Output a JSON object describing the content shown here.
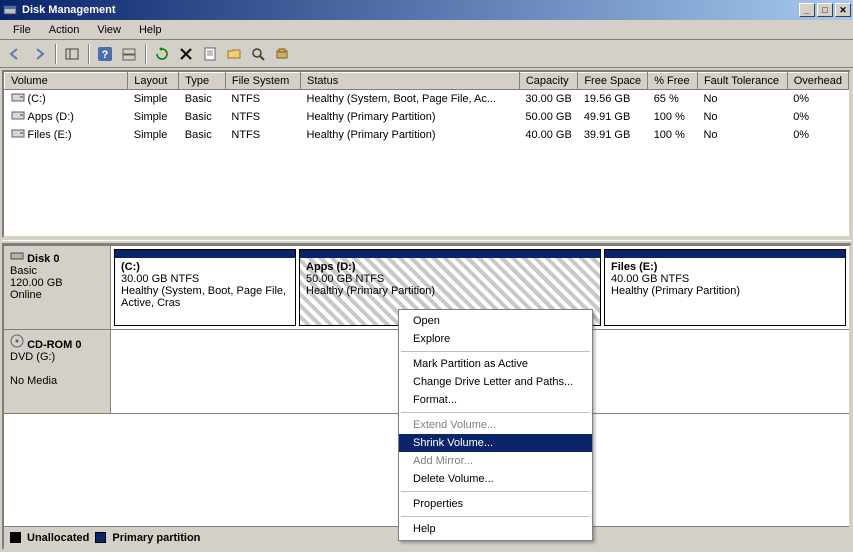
{
  "window": {
    "title": "Disk Management"
  },
  "menu": {
    "file": "File",
    "action": "Action",
    "view": "View",
    "help": "Help"
  },
  "columns": {
    "volume": "Volume",
    "layout": "Layout",
    "type": "Type",
    "fs": "File System",
    "status": "Status",
    "capacity": "Capacity",
    "free": "Free Space",
    "pct": "% Free",
    "fault": "Fault Tolerance",
    "overhead": "Overhead"
  },
  "volumes": [
    {
      "icon": "drive-icon",
      "name": "(C:)",
      "layout": "Simple",
      "type": "Basic",
      "fs": "NTFS",
      "status": "Healthy (System, Boot, Page File, Ac...",
      "capacity": "30.00 GB",
      "free": "19.56 GB",
      "pct": "65 %",
      "fault": "No",
      "overhead": "0%"
    },
    {
      "icon": "drive-icon",
      "name": "Apps (D:)",
      "layout": "Simple",
      "type": "Basic",
      "fs": "NTFS",
      "status": "Healthy (Primary Partition)",
      "capacity": "50.00 GB",
      "free": "49.91 GB",
      "pct": "100 %",
      "fault": "No",
      "overhead": "0%"
    },
    {
      "icon": "drive-icon",
      "name": "Files (E:)",
      "layout": "Simple",
      "type": "Basic",
      "fs": "NTFS",
      "status": "Healthy (Primary Partition)",
      "capacity": "40.00 GB",
      "free": "39.91 GB",
      "pct": "100 %",
      "fault": "No",
      "overhead": "0%"
    }
  ],
  "disk0": {
    "title": "Disk 0",
    "type": "Basic",
    "size": "120.00 GB",
    "state": "Online",
    "p0": {
      "name": "(C:)",
      "size": "30.00 GB NTFS",
      "status": "Healthy (System, Boot, Page File, Active, Cras"
    },
    "p1": {
      "name": "Apps  (D:)",
      "size": "50.00 GB NTFS",
      "status": "Healthy (Primary Partition)"
    },
    "p2": {
      "name": "Files  (E:)",
      "size": "40.00 GB NTFS",
      "status": "Healthy (Primary Partition)"
    }
  },
  "cdrom": {
    "title": "CD-ROM 0",
    "drive": "DVD (G:)",
    "state": "No Media"
  },
  "legend": {
    "unalloc": "Unallocated",
    "primary": "Primary partition"
  },
  "ctx": {
    "open": "Open",
    "explore": "Explore",
    "mark_active": "Mark Partition as Active",
    "change_letter": "Change Drive Letter and Paths...",
    "format": "Format...",
    "extend": "Extend Volume...",
    "shrink": "Shrink Volume...",
    "add_mirror": "Add Mirror...",
    "delete": "Delete Volume...",
    "properties": "Properties",
    "help": "Help"
  }
}
